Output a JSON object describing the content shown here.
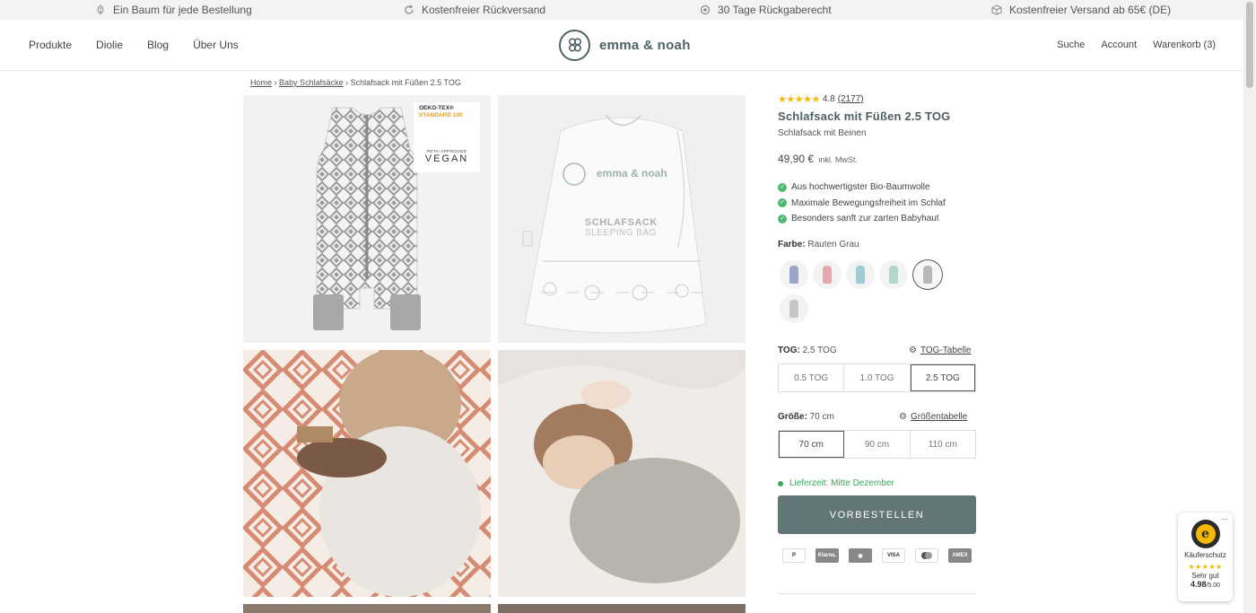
{
  "announcement": {
    "items": [
      {
        "icon": "leaf-icon",
        "text": "Ein Baum für jede Bestellung"
      },
      {
        "icon": "refresh-icon",
        "text": "Kostenfreier Rückversand"
      },
      {
        "icon": "shield-icon",
        "text": "30 Tage Rückgaberecht"
      },
      {
        "icon": "box-icon",
        "text": "Kostenfreier Versand ab 65€ (DE)"
      }
    ]
  },
  "header": {
    "nav_left": [
      "Produkte",
      "Diolie",
      "Blog",
      "Über Uns"
    ],
    "logo_text": "emma & noah",
    "nav_right": {
      "search": "Suche",
      "account": "Account",
      "cart": "Warenkorb (3)"
    }
  },
  "breadcrumb": {
    "home": "Home",
    "category": "Baby Schlafsäcke",
    "current": "Schlafsack mit Füßen 2.5 TOG",
    "separator": "›"
  },
  "gallery": {
    "oeko_line1": "OEKO-TEX®",
    "oeko_line2": "STANDARD 100",
    "vegan_top": "PETA-APPROVED",
    "vegan_main": "VEGAN",
    "bag_brand": "emma & noah",
    "bag_title1": "SCHLAFSACK",
    "bag_title2": "SLEEPING BAG"
  },
  "product": {
    "stars": "★★★★★",
    "rating": "4.8",
    "review_count": "(2177)",
    "title": "Schlafsack mit Füßen 2.5 TOG",
    "subtitle": "Schlafsack mit Beinen",
    "price": "49,90 €",
    "vat": "inkl. MwSt.",
    "benefits": [
      "Aus hochwertigster Bio-Baumwolle",
      "Maximale Bewegungsfreiheit im Schlaf",
      "Besonders sanft zur zarten Babyhaut"
    ],
    "color_label": "Farbe:",
    "color_value": "Rauten Grau",
    "swatches": [
      {
        "name": "Blau",
        "color": "#9aa6c9"
      },
      {
        "name": "Rosa",
        "color": "#e3a9ad"
      },
      {
        "name": "Hellblau",
        "color": "#9ecad4"
      },
      {
        "name": "Mint",
        "color": "#b1d8c8"
      },
      {
        "name": "Rauten Grau",
        "color": "#b9b9b9"
      },
      {
        "name": "Grau",
        "color": "#c6c6c6"
      }
    ],
    "tog_label": "TOG:",
    "tog_value": "2.5 TOG",
    "tog_table_link": "TOG-Tabelle",
    "tog_options": [
      "0.5 TOG",
      "1.0 TOG",
      "2.5 TOG"
    ],
    "tog_selected": "2.5 TOG",
    "size_label": "Größe:",
    "size_value": "70 cm",
    "size_table_link": "Größentabelle",
    "size_options": [
      "70 cm",
      "90 cm",
      "110 cm"
    ],
    "size_selected": "70 cm",
    "delivery": "Lieferzeit: Mitte Dezember",
    "cta": "VORBESTELLEN",
    "payments": [
      "P",
      "Klarna.",
      "",
      "VISA",
      "",
      "AMEX"
    ]
  },
  "trusted": {
    "label": "Käuferschutz",
    "stars": "★★★★★",
    "grade": "Sehr gut",
    "score": "4.98",
    "max": "/5.00",
    "more": "..."
  },
  "colors": {
    "accent": "#627677",
    "brand": "#4f6264",
    "stars": "#f5b800",
    "success": "#3ca85e"
  }
}
